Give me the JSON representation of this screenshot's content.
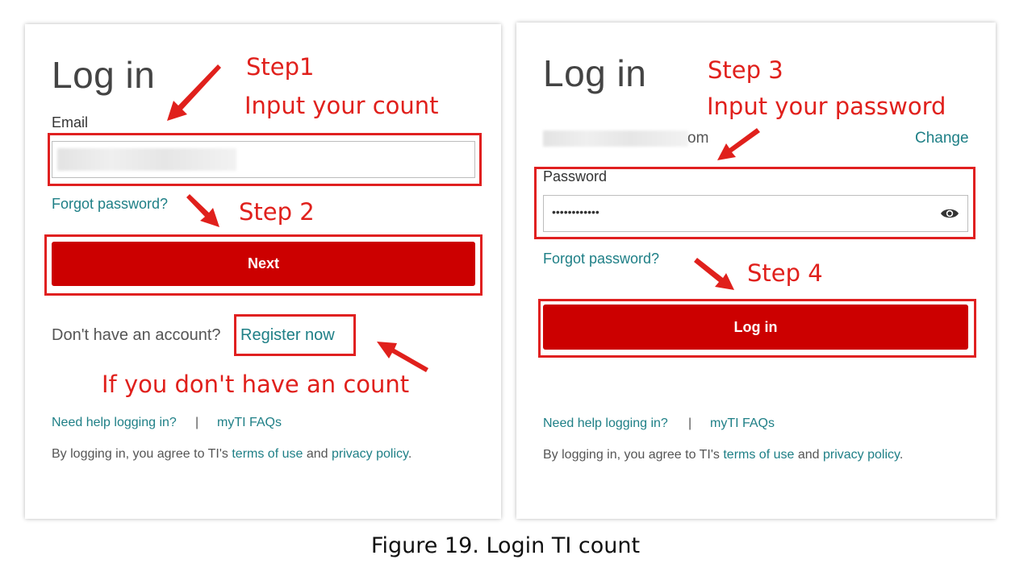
{
  "left": {
    "title": "Log in",
    "email_label": "Email",
    "forgot_password": "Forgot password?",
    "next_button": "Next",
    "no_account_text": "Don't have an account?",
    "register_link": "Register now",
    "need_help": "Need help logging in?",
    "separator": "|",
    "faqs": "myTI FAQs",
    "terms_prefix": "By logging in, you agree to TI's ",
    "terms_link": "terms of use",
    "terms_and": " and ",
    "privacy_link": "privacy policy",
    "terms_suffix": "."
  },
  "right": {
    "title": "Log in",
    "email_suffix": "om",
    "change_link": "Change",
    "password_label": "Password",
    "password_value": "••••••••••••",
    "forgot_password": "Forgot password?",
    "login_button": "Log in",
    "need_help": "Need help logging in?",
    "separator": "|",
    "faqs": "myTI FAQs",
    "terms_prefix": "By logging in, you agree to TI's ",
    "terms_link": "terms of use",
    "terms_and": " and ",
    "privacy_link": "privacy policy",
    "terms_suffix": "."
  },
  "annotations": {
    "step1": "Step1",
    "step1_desc": "Input your count",
    "step2": "Step 2",
    "step3": "Step 3",
    "step3_desc": "Input your password",
    "step4": "Step 4",
    "register_hint": "If you don't have an count"
  },
  "caption": "Figure 19. Login TI count",
  "colors": {
    "brand_red": "#cc0000",
    "link_teal": "#1e7f86",
    "annotation_red": "#e0201c"
  }
}
